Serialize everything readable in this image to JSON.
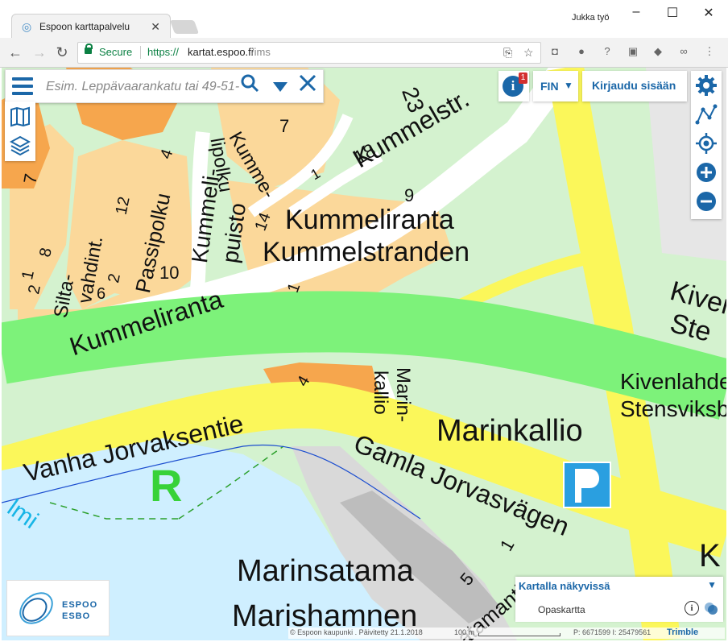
{
  "browser": {
    "tab_title": "Espoon karttapalvelu",
    "profile_name": "Jukka työ",
    "secure_label": "Secure",
    "url_scheme": "https://",
    "url_host": "kartat.espoo.fi",
    "url_path": "/ims"
  },
  "search": {
    "placeholder": "Esim. Leppävaarankatu tai 49-51-..."
  },
  "header": {
    "info_badge": "1",
    "info_icon_glyph": "i",
    "language": "FIN",
    "login_label": "Kirjaudu sisään"
  },
  "map": {
    "labels": {
      "kummelstr": "Kummelstr.",
      "n23": "23",
      "n7a": "7",
      "n18": "18",
      "n9": "9",
      "n1a": "1",
      "n4a": "4",
      "kummeli_puisto": "Kummeli-",
      "puisto": "puisto",
      "kumme_lipolku": "Kumme-",
      "lipolku": "lipolku",
      "n14": "14",
      "n12": "12",
      "passipolku": "Passipolku",
      "n10": "10",
      "n2a": "2",
      "n6": "6",
      "n8": "8",
      "silta": "Silta-",
      "vahdint": "vahdint.",
      "n1b": "1",
      "n2b": "2",
      "kummeliranta_fi": "Kummeliranta",
      "kummelstranden": "Kummelstranden",
      "kummeliranta_road": "Kummeliranta",
      "n1c": "1",
      "n7b": "7",
      "kiven": "Kiven",
      "ste": "Ste",
      "n4b": "4",
      "marin": "Marin-",
      "kallio_road": "kallio",
      "kivenlahde": "Kivenlahde",
      "stensviksb": "Stensviksb",
      "marinkallio": "Marinkallio",
      "vanha_jorvaksentie": "Vanha Jorvaksentie",
      "gamla_jorvasvagen": "Gamla Jorvasvägen",
      "r_zone": "R",
      "lmi": "lmi",
      "marinsatama": "Marinsatama",
      "marishamnen": "Marishamnen",
      "n5": "5",
      "n1d": "1",
      "atamantie": "atamantie",
      "k_edge": "K"
    }
  },
  "layers_panel": {
    "title": "Kartalla näkyvissä",
    "item": "Opaskartta"
  },
  "logo": {
    "line1": "ESPOO",
    "line2": "ESBO"
  },
  "footer": {
    "copyright": "© Espoon kaupunki . Päivitetty 21.1.2018",
    "scale": "100 m",
    "coords": "P: 6671599 I: 25479561",
    "provider": "Trimble"
  },
  "colors": {
    "accent": "#1b67a8",
    "green_park": "#d4f2cf",
    "motorway": "#7df27a",
    "yellow_road": "#fbf75a",
    "residential": "#fbd89a",
    "commercial": "#f6a64d",
    "water": "#cfefff"
  }
}
